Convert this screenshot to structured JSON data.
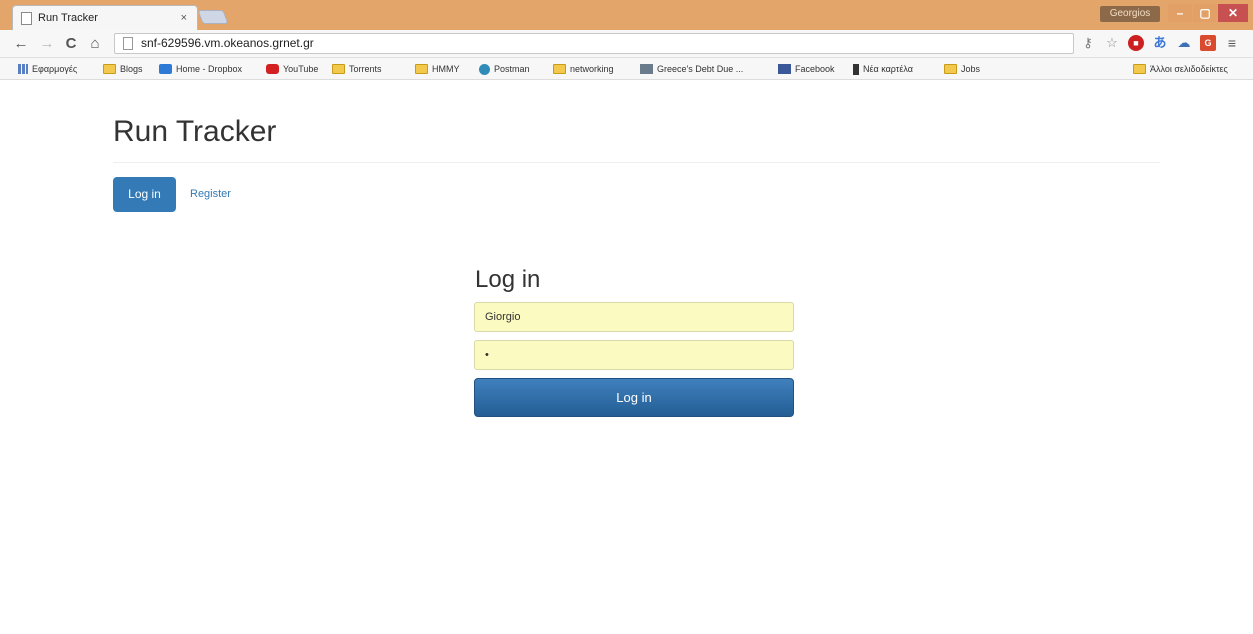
{
  "browser": {
    "tab_title": "Run Tracker",
    "tab_close": "×",
    "user_badge": "Georgios",
    "window_controls": {
      "minimize": "–",
      "maximize": "▢",
      "close": "✕"
    },
    "nav": {
      "back": "←",
      "forward": "→",
      "reload": "C",
      "home": "⌂"
    },
    "url": "snf-629596.vm.okeanos.grnet.gr",
    "extensions": [
      {
        "name": "key-icon",
        "glyph": "⚷"
      },
      {
        "name": "star-icon",
        "glyph": "☆"
      },
      {
        "name": "stop-icon",
        "glyph": "●"
      },
      {
        "name": "translate-icon",
        "glyph": "あ"
      },
      {
        "name": "cloud-icon",
        "glyph": "☁"
      },
      {
        "name": "badge-icon",
        "glyph": "G"
      },
      {
        "name": "menu-icon",
        "glyph": "≡"
      }
    ]
  },
  "bookmarks": [
    {
      "label": "Εφαρμογές",
      "icon": "apps-icon"
    },
    {
      "label": "Blogs",
      "icon": "folder-icon"
    },
    {
      "label": "Home - Dropbox",
      "icon": "dropbox-icon"
    },
    {
      "label": "YouTube",
      "icon": "youtube-icon"
    },
    {
      "label": "Torrents",
      "icon": "folder-icon"
    },
    {
      "label": "HMMY",
      "icon": "folder-icon"
    },
    {
      "label": "Postman",
      "icon": "postman-icon"
    },
    {
      "label": "networking",
      "icon": "folder-icon"
    },
    {
      "label": "Greece's Debt Due ...",
      "icon": "document-icon"
    },
    {
      "label": "Facebook",
      "icon": "facebook-icon"
    },
    {
      "label": "Νέα καρτέλα",
      "icon": "pin-icon"
    },
    {
      "label": "Jobs",
      "icon": "folder-icon"
    }
  ],
  "other_bookmarks": "Άλλοι σελιδοδείκτες",
  "page": {
    "title": "Run Tracker",
    "nav": {
      "active": "Log in",
      "link": "Register"
    },
    "login": {
      "heading": "Log in",
      "username_value": "Giorgio",
      "password_value": "•",
      "submit": "Log in"
    }
  },
  "colors": {
    "titlebar": "#e4a56b",
    "primary": "#337ab7",
    "autofill": "#fbfbc1"
  }
}
